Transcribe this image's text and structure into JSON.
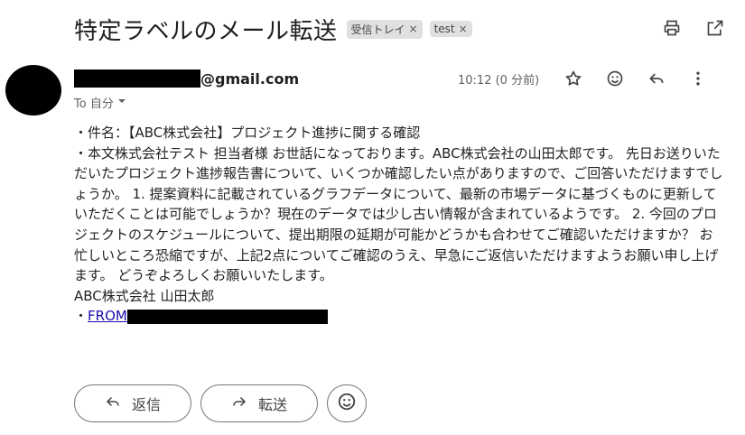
{
  "subject": {
    "title": "特定ラベルのメール転送"
  },
  "labels": [
    {
      "text": "受信トレイ",
      "remove": "×"
    },
    {
      "text": "test",
      "remove": "×"
    }
  ],
  "sender": {
    "email_suffix": "@gmail.com"
  },
  "recipient": {
    "line": "To 自分"
  },
  "time": "10:12 (0 分前)",
  "body": {
    "line1": "・件名：【ABC株式会社】プロジェクト進捗に関する確認",
    "paragraph": "・本文株式会社テスト 担当者様 お世話になっております。ABC株式会社の山田太郎です。 先日お送りいただいたプロジェクト進捗報告書について、いくつか確認したい点がありますので、ご回答いただけますでしょうか。 1. 提案資料に記載されているグラフデータについて、最新の市場データに基づくものに更新していただくことは可能でしょうか？現在のデータでは少し古い情報が含まれているようです。 2. 今回のプロジェクトのスケジュールについて、提出期限の延期が可能かどうかも合わせてご確認いただけますか？ お忙しいところ恐縮ですが、上記2点についてご確認のうえ、早急にご返信いただけますようお願い申し上げます。 どうぞよろしくお願いいたします。",
    "signature": "ABC株式会社 山田太郎",
    "from_prefix": "・",
    "from_link": "FROM"
  },
  "buttons": {
    "reply": "返信",
    "forward": "転送"
  },
  "icons": {
    "print": "print-icon",
    "open_new": "open-in-new-icon",
    "star": "star-icon",
    "emoji": "emoji-icon",
    "reply": "reply-icon",
    "more": "more-vert-icon"
  }
}
